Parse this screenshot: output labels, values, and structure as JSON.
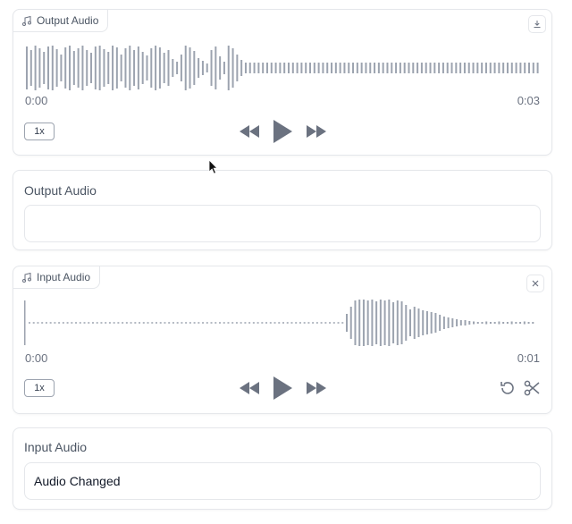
{
  "output_audio_player": {
    "label": "Output Audio",
    "icon": "music-note-icon",
    "start_time": "0:00",
    "end_time": "0:03",
    "speed": "1x"
  },
  "output_audio_text": {
    "label": "Output Audio",
    "value": ""
  },
  "input_audio_player": {
    "label": "Input Audio",
    "icon": "music-note-icon",
    "start_time": "0:00",
    "end_time": "0:01",
    "speed": "1x"
  },
  "input_audio_text": {
    "label": "Input Audio",
    "value": "Audio Changed"
  },
  "colors": {
    "waveform": "#9ca3af",
    "icon": "#6b7280",
    "border": "#e5e7eb"
  }
}
